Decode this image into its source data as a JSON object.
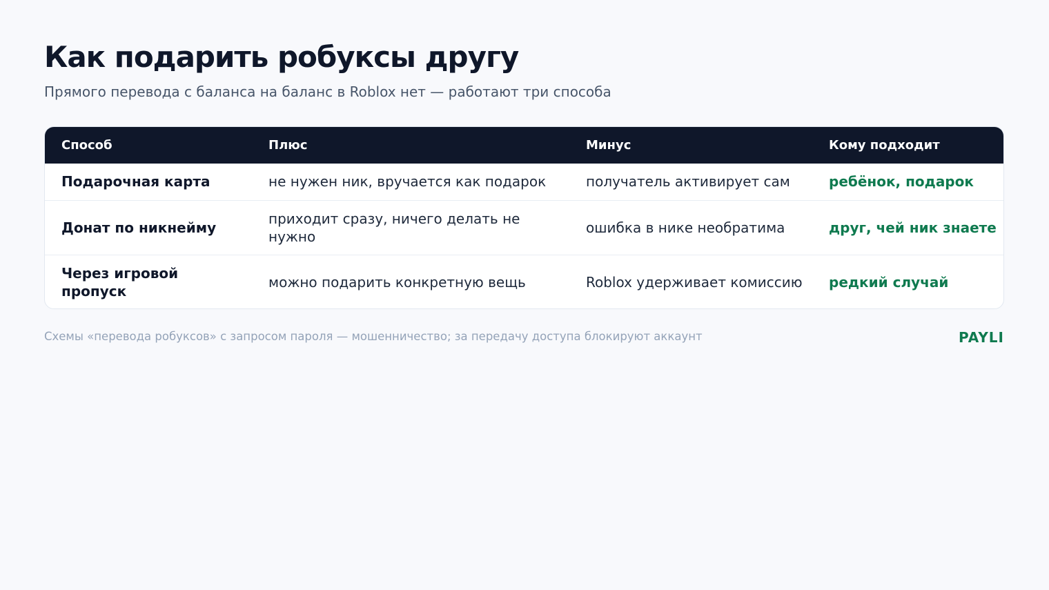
{
  "header": {
    "title": "Как подарить робуксы другу",
    "subtitle": "Прямого перевода с баланса на баланс в Roblox нет — работают три способа"
  },
  "table": {
    "columns": [
      "Способ",
      "Плюс",
      "Минус",
      "Кому подходит"
    ],
    "rows": [
      [
        "Подарочная карта",
        "не нужен ник, вручается как подарок",
        "получатель активирует сам",
        "ребёнок, подарок"
      ],
      [
        "Донат по никнейму",
        "приходит сразу, ничего делать не нужно",
        "ошибка в нике необратима",
        "друг, чей ник знаете"
      ],
      [
        "Через игровой пропуск",
        "можно подарить конкретную вещь",
        "Roblox удерживает комиссию",
        "редкий случай"
      ]
    ]
  },
  "footer": {
    "note": "Схемы «перевода робуксов» с запросом пароля — мошенничество; за передачу доступа блокируют аккаунт",
    "brand": "PAYLI"
  },
  "colors": {
    "header_bg": "#0f172a",
    "accent_green": "#0f7a4f",
    "page_bg": "#f8f9fc"
  }
}
